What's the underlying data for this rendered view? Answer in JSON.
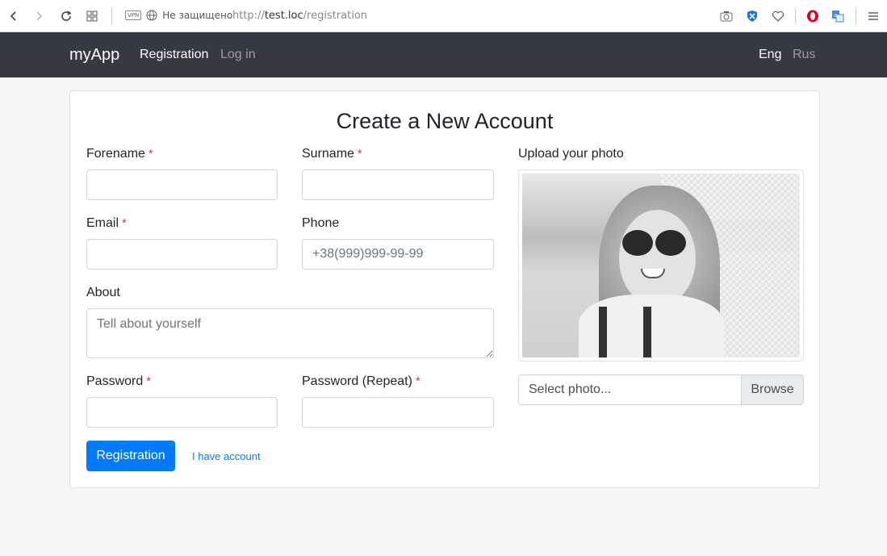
{
  "browser": {
    "security_text": "Не защищено",
    "vpn_badge": "VPN",
    "url_scheme": "http://",
    "url_host": "test.loc",
    "url_path": "/registration"
  },
  "navbar": {
    "brand": "myApp",
    "links": [
      {
        "label": "Registration",
        "active": true
      },
      {
        "label": "Log in",
        "active": false
      }
    ],
    "languages": [
      {
        "label": "Eng",
        "active": true
      },
      {
        "label": "Rus",
        "active": false
      }
    ]
  },
  "form": {
    "title": "Create a New Account",
    "required_mark": "*",
    "forename": {
      "label": "Forename",
      "value": "",
      "placeholder": ""
    },
    "surname": {
      "label": "Surname",
      "value": "",
      "placeholder": ""
    },
    "email": {
      "label": "Email",
      "value": "",
      "placeholder": ""
    },
    "phone": {
      "label": "Phone",
      "value": "",
      "placeholder": "+38(999)999-99-99"
    },
    "about": {
      "label": "About",
      "value": "",
      "placeholder": "Tell about yourself"
    },
    "password": {
      "label": "Password",
      "value": "",
      "placeholder": ""
    },
    "password_repeat": {
      "label": "Password (Repeat)",
      "value": "",
      "placeholder": ""
    },
    "submit_label": "Registration",
    "have_account_label": "I have account"
  },
  "photo": {
    "label": "Upload your photo",
    "file_placeholder": "Select photo...",
    "browse_label": "Browse"
  },
  "colors": {
    "navbar_bg": "#343a40",
    "primary": "#007bff",
    "required": "#dc3545",
    "page_bg": "#f5f6f8"
  }
}
